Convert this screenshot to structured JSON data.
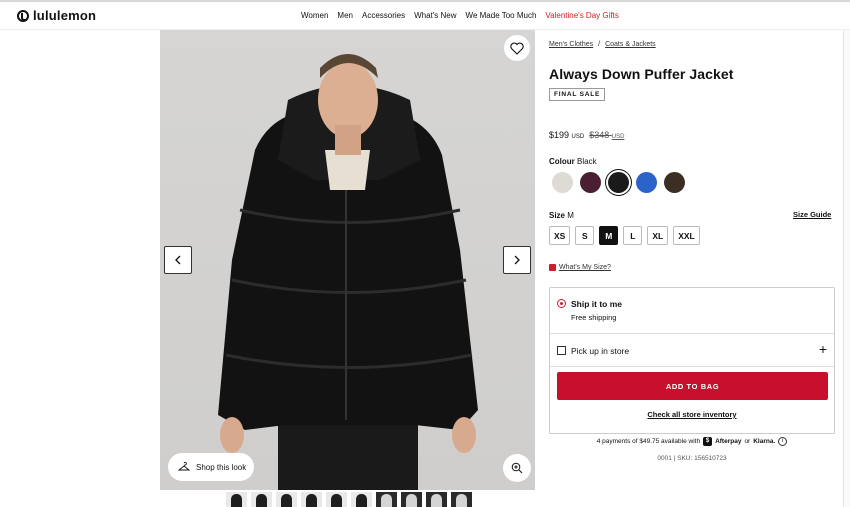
{
  "header": {
    "logo_text": "lululemon",
    "nav": [
      "Women",
      "Men",
      "Accessories",
      "What's New",
      "We Made Too Much"
    ],
    "nav_highlight": "Valentine's Day Gifts"
  },
  "gallery": {
    "shop_look_label": "Shop this look",
    "prev_icon": "chevron-left-icon",
    "next_icon": "chevron-right-icon",
    "thumbnail_count": 10
  },
  "product": {
    "breadcrumb": [
      "Men's Clothes",
      "/",
      "Coats & Jackets"
    ],
    "title": "Always Down Puffer Jacket",
    "badge": "FINAL SALE",
    "price": "$199",
    "price_currency": "USD",
    "was_price": "$348",
    "was_currency": "USD",
    "colour_label": "Colour",
    "colour_value": "Black",
    "swatches": [
      "#dedbd5",
      "#4a1f31",
      "#1a1a1a",
      "#2c63c9",
      "#3b2f25"
    ],
    "selected_swatch": 2,
    "size_label": "Size",
    "size_value": "M",
    "size_guide": "Size Guide",
    "sizes": [
      "XS",
      "S",
      "M",
      "L",
      "XL",
      "XXL"
    ],
    "selected_size": "M",
    "fit_link": "What's My Size?"
  },
  "fulfilment": {
    "ship_title": "Ship it to me",
    "ship_sub": "Free shipping",
    "pickup_label": "Pick up in store",
    "add_to_bag": "ADD TO BAG",
    "check_inventory": "Check all store inventory"
  },
  "payments": {
    "text": "4 payments of $49.75 available with",
    "afterpay": "Afterpay",
    "or": "or",
    "klarna": "Klarna."
  },
  "sku": "0001 | SKU: 156510723",
  "colors": {
    "accent_red": "#c8102e",
    "nav_red": "#d31c29"
  }
}
